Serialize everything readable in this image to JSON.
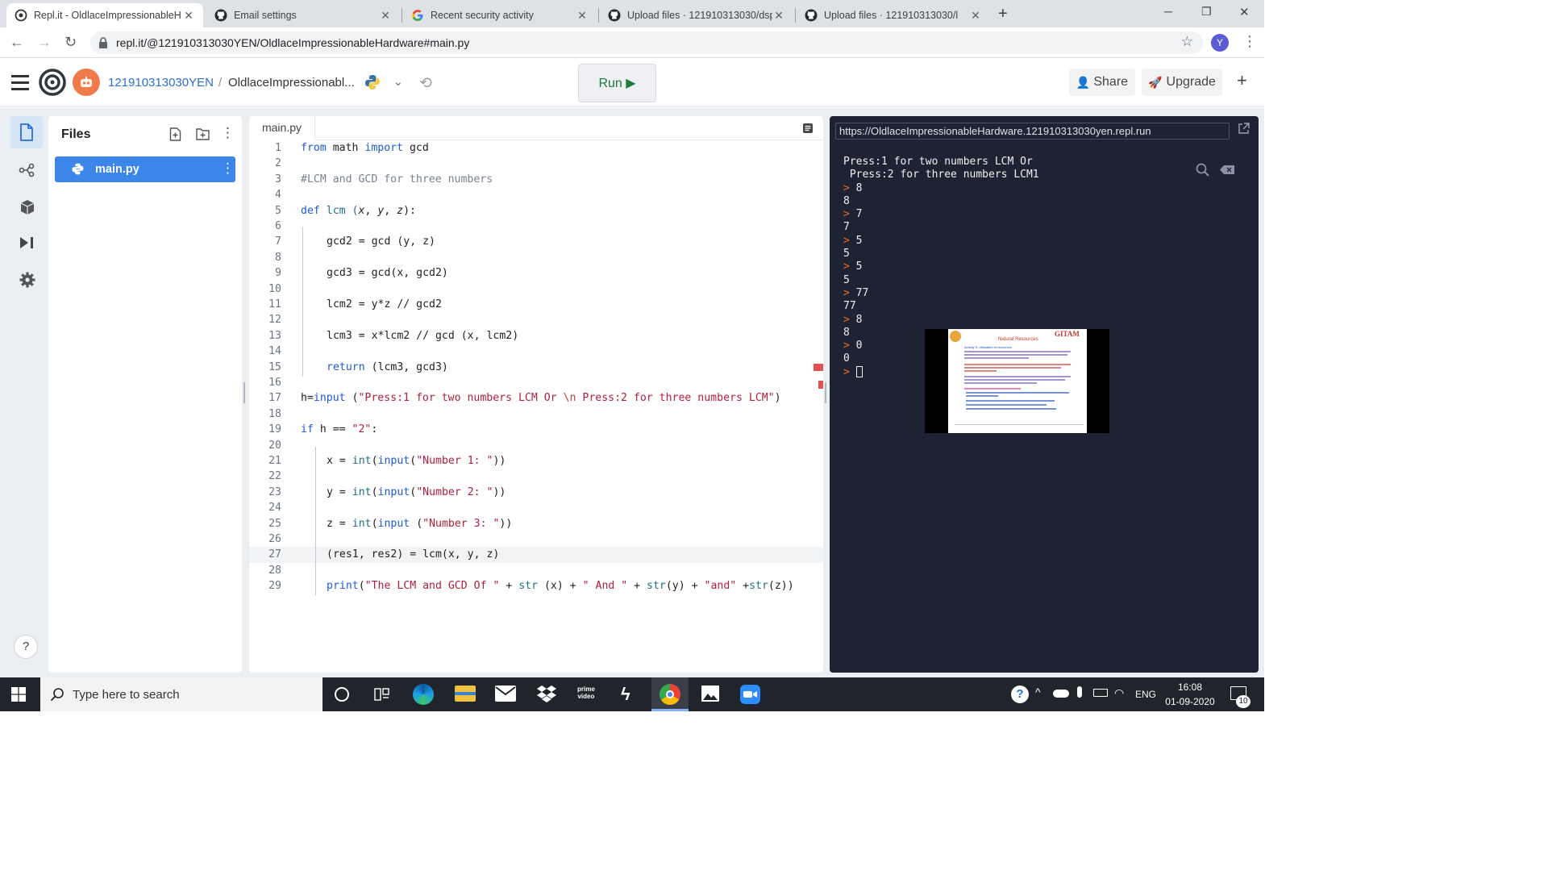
{
  "browser": {
    "tabs": [
      {
        "title": "Repl.it - OldlaceImpressionableH",
        "icon": "replit-icon",
        "active": true
      },
      {
        "title": "Email settings",
        "icon": "github-icon",
        "active": false
      },
      {
        "title": "Recent security activity",
        "icon": "google-icon",
        "active": false
      },
      {
        "title": "Upload files · 121910313030/dsp",
        "icon": "github-icon",
        "active": false
      },
      {
        "title": "Upload files · 121910313030/l",
        "icon": "github-icon",
        "active": false
      }
    ],
    "new_tab": "+",
    "url": "repl.it/@121910313030YEN/OldlaceImpressionableHardware#main.py",
    "profile_initial": "Y",
    "window_controls": {
      "minimize": "─",
      "maximize": "❐",
      "close": "✕"
    }
  },
  "repl": {
    "username": "121910313030YEN",
    "separator": "/",
    "repl_name": "OldlaceImpressionabl...",
    "run_label": "Run ▶",
    "share_label": "Share",
    "upgrade_label": "Upgrade",
    "add_label": "+"
  },
  "files": {
    "title": "Files",
    "items": [
      {
        "name": "main.py",
        "selected": true
      }
    ]
  },
  "editor": {
    "tab_label": "main.py",
    "lines": [
      {
        "n": "1"
      },
      {
        "n": "2"
      },
      {
        "n": "3"
      },
      {
        "n": "4"
      },
      {
        "n": "5"
      },
      {
        "n": "6"
      },
      {
        "n": "7"
      },
      {
        "n": "8"
      },
      {
        "n": "9"
      },
      {
        "n": "10"
      },
      {
        "n": "11"
      },
      {
        "n": "12"
      },
      {
        "n": "13"
      },
      {
        "n": "14"
      },
      {
        "n": "15"
      },
      {
        "n": "16"
      },
      {
        "n": "17"
      },
      {
        "n": "18"
      },
      {
        "n": "19"
      },
      {
        "n": "20"
      },
      {
        "n": "21"
      },
      {
        "n": "22"
      },
      {
        "n": "23"
      },
      {
        "n": "24"
      },
      {
        "n": "25"
      },
      {
        "n": "26"
      },
      {
        "n": "27"
      },
      {
        "n": "28"
      },
      {
        "n": "29"
      }
    ],
    "code": {
      "l1": [
        "from",
        " math ",
        "import",
        " gcd"
      ],
      "l3": "#LCM and GCD for three numbers",
      "l5": [
        "def",
        " lcm (",
        "x",
        ", ",
        "y",
        ", ",
        "z",
        "):"
      ],
      "l7": "gcd2 = gcd (y, z)",
      "l9": "gcd3 = gcd(x, gcd2)",
      "l11": "lcm2 = y*z // gcd2",
      "l13": "lcm3 = x*lcm2 // gcd (x, lcm2)",
      "l15": [
        "return",
        " (lcm3, gcd3)"
      ],
      "l17": [
        "h=",
        "input",
        " (",
        "\"Press:1 for two numbers LCM Or ",
        "\\n",
        " Press:2 for three numbers LCM\"",
        ")"
      ],
      "l19": [
        "if",
        " h == ",
        "\"2\"",
        ":"
      ],
      "l21": [
        "x = ",
        "int",
        "(",
        "input",
        "(",
        "\"Number 1: \"",
        "))"
      ],
      "l23": [
        "y = ",
        "int",
        "(",
        "input",
        "(",
        "\"Number 2: \"",
        "))"
      ],
      "l25": [
        "z = ",
        "int",
        "(",
        "input",
        " (",
        "\"Number 3: \"",
        "))"
      ],
      "l27": "(res1, res2) = lcm(x, y, z)",
      "l29": [
        "print",
        "(",
        "\"The LCM and GCD Of \"",
        " + ",
        "str",
        " (x) + ",
        "\" And \"",
        " + ",
        "str",
        "(y) + ",
        "\"and\"",
        " +",
        "str",
        "(z))"
      ]
    }
  },
  "console": {
    "url": "https://OldlaceImpressionableHardware.121910313030yen.repl.run",
    "lines": [
      {
        "prompt": false,
        "text": "Press:1 for two numbers LCM Or"
      },
      {
        "prompt": false,
        "text": " Press:2 for three numbers LCM1"
      },
      {
        "prompt": true,
        "text": "8"
      },
      {
        "prompt": false,
        "text": "8"
      },
      {
        "prompt": true,
        "text": "7"
      },
      {
        "prompt": false,
        "text": "7"
      },
      {
        "prompt": true,
        "text": "5"
      },
      {
        "prompt": false,
        "text": "5"
      },
      {
        "prompt": true,
        "text": "5"
      },
      {
        "prompt": false,
        "text": "5"
      },
      {
        "prompt": true,
        "text": "77"
      },
      {
        "prompt": false,
        "text": "77"
      },
      {
        "prompt": true,
        "text": "8"
      },
      {
        "prompt": false,
        "text": "8"
      },
      {
        "prompt": true,
        "text": "0"
      },
      {
        "prompt": false,
        "text": "0"
      }
    ],
    "prompt_glyph": ">",
    "overlay": {
      "brand": "GITAM",
      "title": "Natural Resources",
      "subtitle": "Activity 3: Utilisation of resources"
    }
  },
  "taskbar": {
    "search_placeholder": "Type here to search",
    "language": "ENG",
    "time": "16:08",
    "date": "01-09-2020",
    "notification_count": "10"
  },
  "colors": {
    "accent": "#1a73e8",
    "replit_blue": "#3485e4",
    "console_bg": "#1d2333",
    "prompt_orange": "#f26d21",
    "tab_bar": "#dee1e6"
  }
}
